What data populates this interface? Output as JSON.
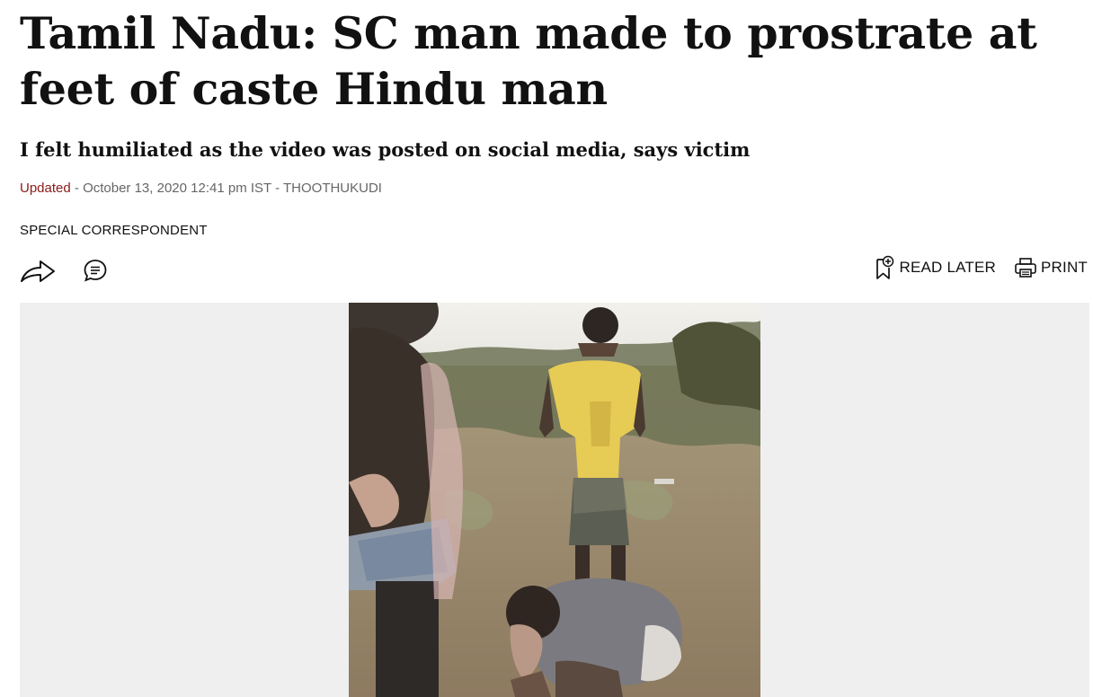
{
  "article": {
    "headline": "Tamil Nadu: SC man made to prostrate at feet of caste Hindu man",
    "subheadline": "I felt humiliated as the video was posted on social media, says victim",
    "dateline": {
      "updated_label": "Updated",
      "separator1": " - ",
      "date": "October 13, 2020 12:41 pm IST",
      "separator2": " - ",
      "location": "THOOTHUKUDI"
    },
    "byline": "SPECIAL CORRESPONDENT"
  },
  "toolbar": {
    "share_icon": "share-arrow-icon",
    "comment_icon": "comment-bubble-icon",
    "read_later_label": "READ LATER",
    "read_later_icon": "bookmark-plus-icon",
    "print_label": "PRINT",
    "print_icon": "printer-icon"
  },
  "colors": {
    "accent": "#8b1a1a",
    "meta_text": "#666666",
    "media_background": "#efefef"
  }
}
